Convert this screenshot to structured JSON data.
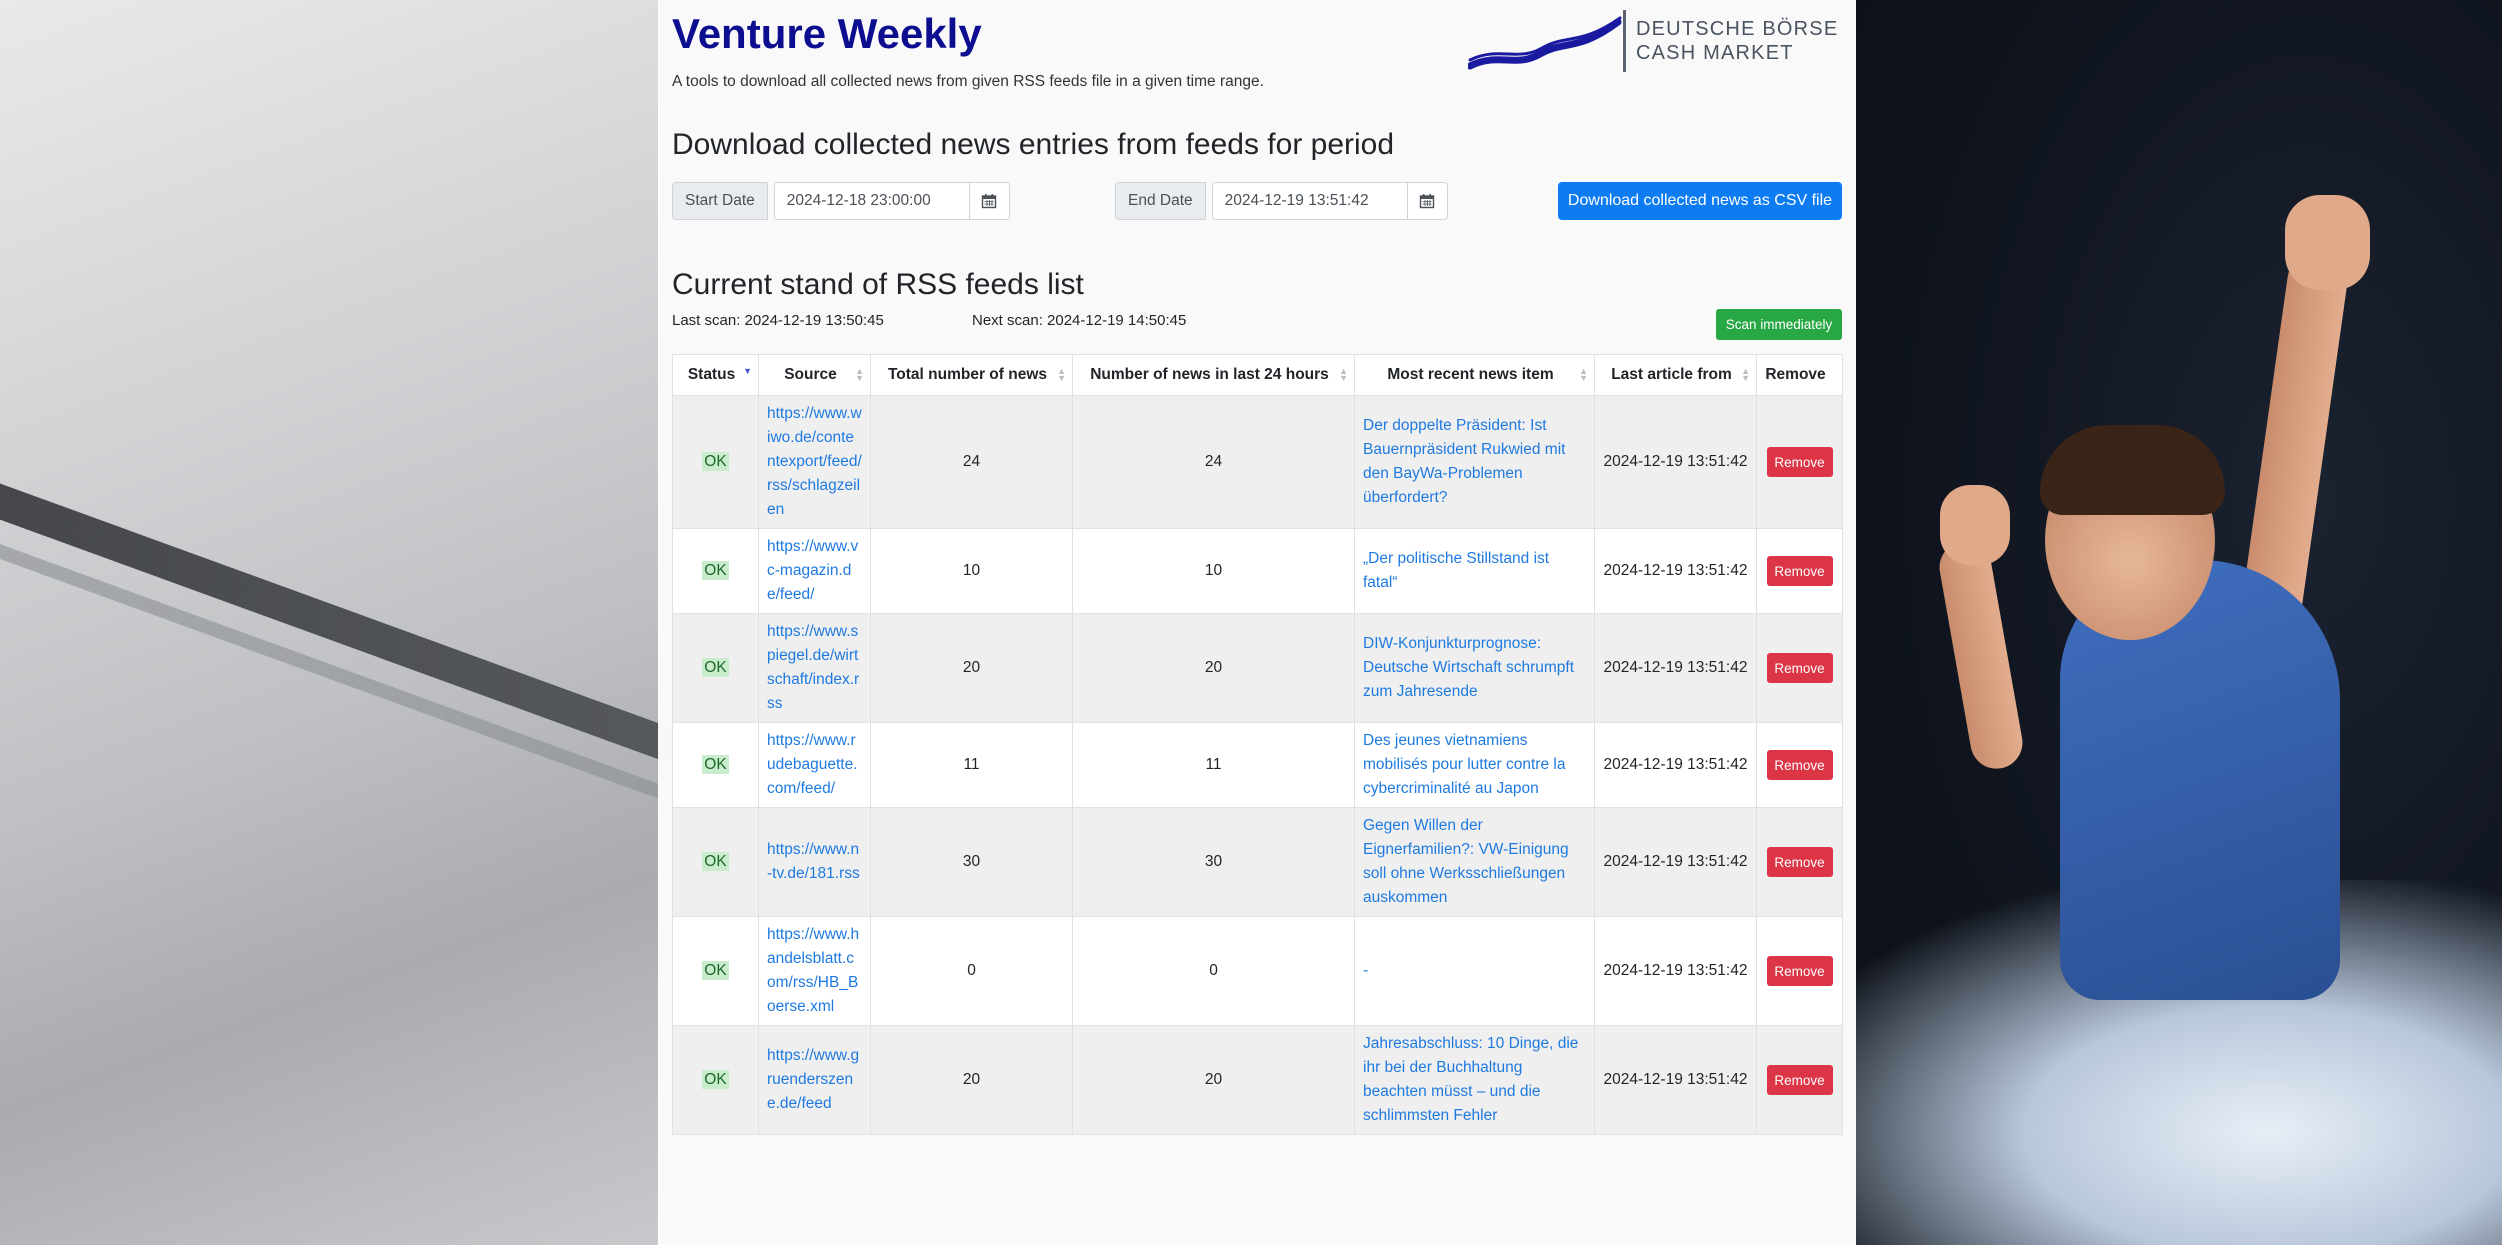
{
  "app": {
    "title": "Venture Weekly",
    "subtitle": "A tools to download all collected news from given RSS feeds file in a given time range.",
    "logo_line1": "DEUTSCHE BÖRSE",
    "logo_line2": "CASH MARKET"
  },
  "download": {
    "heading": "Download collected news entries from feeds for period",
    "start_label": "Start Date",
    "start_value": "2024-12-18 23:00:00",
    "end_label": "End Date",
    "end_value": "2024-12-19 13:51:42",
    "button_label": "Download collected news as CSV file",
    "calendar_icon": "calendar-icon"
  },
  "feeds": {
    "heading": "Current stand of RSS feeds list",
    "last_scan": "Last scan: 2024-12-19 13:50:45",
    "next_scan": "Next scan: 2024-12-19 14:50:45",
    "scan_button": "Scan immediately",
    "columns": [
      "Status",
      "Source",
      "Total number of news",
      "Number of news in last 24 hours",
      "Most recent news item",
      "Last article from",
      "Remove"
    ],
    "rows": [
      {
        "status": "OK",
        "source": "https://www.wiwo.de/contentexport/feed/rss/schlagzeilen",
        "total": "24",
        "last24": "24",
        "recent": "Der doppelte Präsident: Ist Bauernpräsident Rukwied mit den BayWa-Problemen überfordert?",
        "last_article": "2024-12-19 13:51:42",
        "remove": "Remove"
      },
      {
        "status": "OK",
        "source": "https://www.vc-magazin.de/feed/",
        "total": "10",
        "last24": "10",
        "recent": "„Der politische Stillstand ist fatal“",
        "last_article": "2024-12-19 13:51:42",
        "remove": "Remove"
      },
      {
        "status": "OK",
        "source": "https://www.spiegel.de/wirtschaft/index.rss",
        "total": "20",
        "last24": "20",
        "recent": "DIW-Konjunkturprognose: Deutsche Wirtschaft schrumpft zum Jahresende",
        "last_article": "2024-12-19 13:51:42",
        "remove": "Remove"
      },
      {
        "status": "OK",
        "source": "https://www.rudebaguette.com/feed/",
        "total": "11",
        "last24": "11",
        "recent": "Des jeunes vietnamiens mobilisés pour lutter contre la cybercriminalité au Japon",
        "last_article": "2024-12-19 13:51:42",
        "remove": "Remove"
      },
      {
        "status": "OK",
        "source": "https://www.n-tv.de/181.rss",
        "total": "30",
        "last24": "30",
        "recent": "Gegen Willen der Eignerfamilien?: VW-Einigung soll ohne Werksschließungen auskommen",
        "last_article": "2024-12-19 13:51:42",
        "remove": "Remove"
      },
      {
        "status": "OK",
        "source": "https://www.handelsblatt.com/rss/HB_Boerse.xml",
        "total": "0",
        "last24": "0",
        "recent": "-",
        "last_article": "2024-12-19 13:51:42",
        "remove": "Remove"
      },
      {
        "status": "OK",
        "source": "https://www.gruenderszene.de/feed",
        "total": "20",
        "last24": "20",
        "recent": "Jahresabschluss: 10 Dinge, die ihr bei der Buchhaltung beachten müsst – und die schlimmsten Fehler",
        "last_article": "2024-12-19 13:51:42",
        "remove": "Remove"
      }
    ]
  },
  "colors": {
    "title": "#0d0d8f",
    "primary_button": "#0d7cf2",
    "scan_button": "#28a745",
    "remove_button": "#dc3545",
    "link": "#1f7ae0",
    "ok_badge": "#c9eccd"
  }
}
